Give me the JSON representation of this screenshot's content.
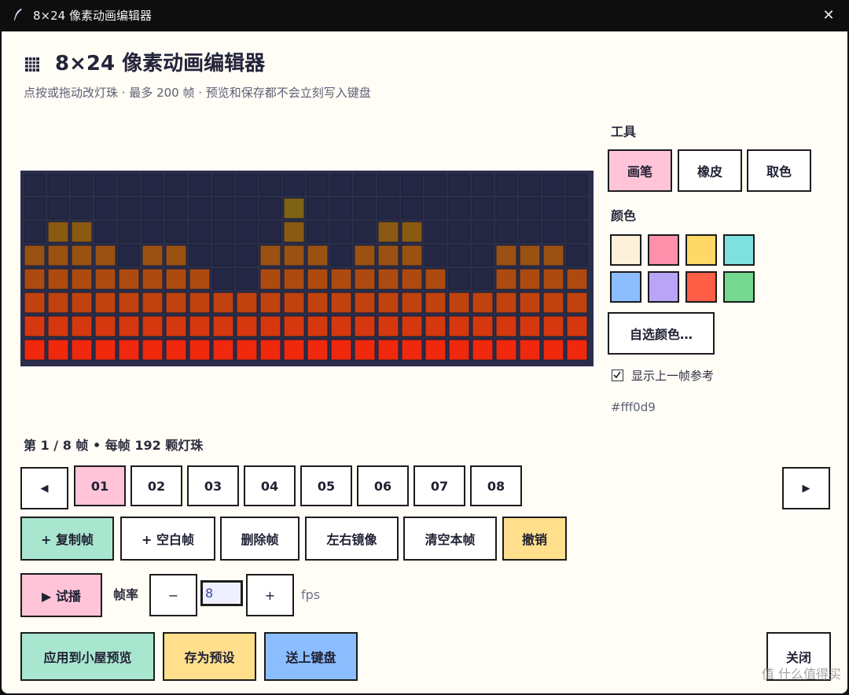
{
  "window": {
    "title": "8×24 像素动画编辑器",
    "close_glyph": "✕"
  },
  "header": {
    "icon": "grid-icon",
    "title": "8×24 像素动画编辑器",
    "subtitle": "点按或拖动改灯珠 · 最多 200 帧 · 预览和保存都不会立刻写入键盘"
  },
  "grid": {
    "rows": 8,
    "cols": 24,
    "background": "#2a2e4a",
    "empty_color": "#242845",
    "column_heights": [
      5,
      6,
      6,
      5,
      4,
      5,
      5,
      4,
      3,
      3,
      5,
      7,
      5,
      4,
      5,
      6,
      6,
      4,
      3,
      3,
      5,
      5,
      5,
      4
    ],
    "row_colors": [
      "#7f6314",
      "#7f6314",
      "#8a5a12",
      "#9a5112",
      "#ad4a10",
      "#c0420f",
      "#d5380e",
      "#f0280c"
    ]
  },
  "tools": {
    "label": "工具",
    "items": [
      {
        "label": "画笔",
        "active": true
      },
      {
        "label": "橡皮",
        "active": false
      },
      {
        "label": "取色",
        "active": false
      }
    ]
  },
  "colors": {
    "label": "颜色",
    "swatches": [
      "#fff0d9",
      "#ff8fab",
      "#ffd866",
      "#7fe0e0",
      "#8cbeff",
      "#b8a5f5",
      "#ff5e47",
      "#74d98f"
    ],
    "custom_label": "自选颜色…",
    "show_prev_label": "显示上一帧参考",
    "show_prev_checked": true,
    "current_hex": "#fff0d9"
  },
  "frames": {
    "label": "第 1 / 8 帧 • 每帧 192 颗灯珠",
    "prev_glyph": "◀",
    "next_glyph": "▶",
    "items": [
      "01",
      "02",
      "03",
      "04",
      "05",
      "06",
      "07",
      "08"
    ],
    "current": 0
  },
  "actions": {
    "duplicate": "+ 复制帧",
    "blank": "+ 空白帧",
    "delete": "删除帧",
    "mirror": "左右镜像",
    "clear": "清空本帧",
    "undo": "撤销"
  },
  "playback": {
    "play": "▶ 试播",
    "fps_label": "帧率",
    "minus": "−",
    "plus": "+",
    "fps_value": "8",
    "fps_unit": "fps"
  },
  "footer": {
    "apply": "应用到小屋预览",
    "save_preset": "存为预设",
    "send": "送上键盘",
    "close": "关闭"
  },
  "watermark": "值 什么值得买"
}
